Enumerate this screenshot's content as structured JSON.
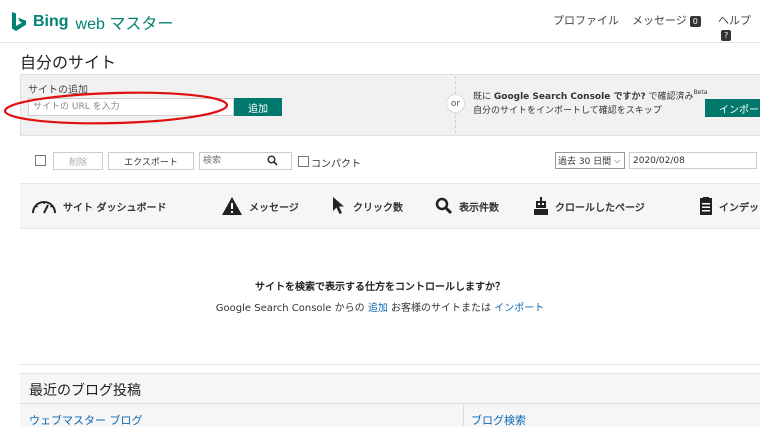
{
  "brand": {
    "name": "Bing",
    "product": "web マスター"
  },
  "topnav": {
    "profile": "プロファイル",
    "messages": "メッセージ",
    "messages_count": "0",
    "help": "ヘルプ",
    "help_badge": "?"
  },
  "page_title": "自分のサイト",
  "add_site": {
    "label": "サイトの追加",
    "placeholder": "サイトの URL を入力",
    "add_button": "追加",
    "or": "or",
    "import_prefix": "既に",
    "import_strong": "Google Search Console ですか?",
    "import_suffix": "で確認済み",
    "beta": "Beta",
    "import_line2": "自分のサイトをインポートして確認をスキップ",
    "import_button": "インポー"
  },
  "toolbar": {
    "delete": "削除",
    "export": "エクスポート",
    "search_placeholder": "検索",
    "compact": "コンパクト",
    "period": "過去 30 日間",
    "date": "2020/02/08"
  },
  "tabs": [
    {
      "label": "サイト ダッシュボード",
      "icon": "gauge-icon"
    },
    {
      "label": "メッセージ",
      "icon": "warning-icon"
    },
    {
      "label": "クリック数",
      "icon": "cursor-icon"
    },
    {
      "label": "表示件数",
      "icon": "search-icon"
    },
    {
      "label": "クロールしたページ",
      "icon": "robot-icon"
    },
    {
      "label": "インデッ",
      "icon": "document-icon"
    }
  ],
  "empty_state": {
    "title": "サイトを検索で表示する仕方をコントロールしますか？",
    "text_prefix": "Google Search Console からの",
    "link_add": "追加",
    "text_middle": "お客様のサイトまたは",
    "link_import": "インポート"
  },
  "blog": {
    "title": "最近のブログ投稿",
    "link1": "ウェブマスター ブログ",
    "link2": "ブログ検索"
  },
  "colors": {
    "brand": "#008373",
    "button": "#00786b",
    "link": "#0c67b3",
    "annotation": "#e01010"
  }
}
